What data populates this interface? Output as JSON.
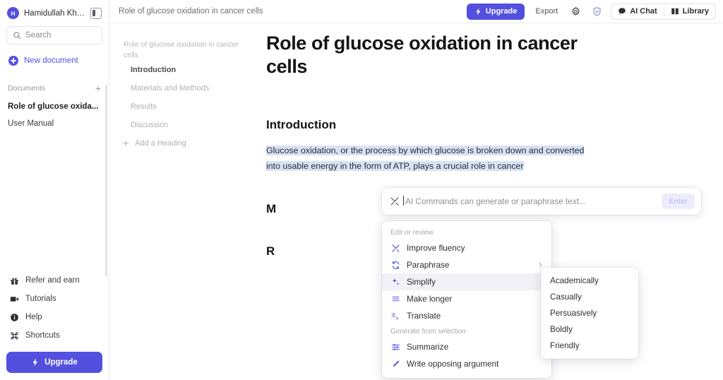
{
  "sidebar": {
    "user": {
      "initial": "H",
      "name": "Hamidullah Khan",
      "avatar_color": "#5350e0"
    },
    "panel_toggle": "toggle-sidebar",
    "search": {
      "placeholder": "Search"
    },
    "new_document": "New document",
    "documents_section": {
      "label": "Documents",
      "add": "+"
    },
    "documents": [
      {
        "label": "Role of glucose oxida...",
        "active": true
      },
      {
        "label": "User Manual",
        "active": false
      }
    ],
    "bottom_links": [
      {
        "label": "Refer and earn",
        "icon": "gift-icon"
      },
      {
        "label": "Tutorials",
        "icon": "video-camera-icon"
      },
      {
        "label": "Help",
        "icon": "info-icon"
      },
      {
        "label": "Shortcuts",
        "icon": "command-icon"
      }
    ],
    "upgrade": {
      "label": "Upgrade",
      "icon": "lightning-icon",
      "color": "#5350e0"
    }
  },
  "topbar": {
    "title": "Role of glucose oxidation in cancer cells",
    "upgrade": "Upgrade",
    "export": "Export",
    "settings_icon": "gear-icon",
    "shield_icon": "shield-check-icon",
    "ai_chat": "AI Chat",
    "library": "Library"
  },
  "outline": {
    "doc_title": "Role of glucose oxidation in cancer cells",
    "items": [
      {
        "label": "Introduction",
        "active": true
      },
      {
        "label": "Materials and Methods",
        "active": false
      },
      {
        "label": "Results",
        "active": false
      },
      {
        "label": "Discussion",
        "active": false
      }
    ],
    "add_heading": "Add a Heading"
  },
  "document": {
    "title": "Role of glucose oxidation in cancer cells",
    "section1_heading": "Introduction",
    "paragraph_highlighted": "Glucose oxidation, or the process by which glucose is broken down and converted into usable energy in the form of ATP, plays a crucial role in cancer",
    "section2_heading": "M",
    "section3_heading": "R"
  },
  "ai_command_bar": {
    "placeholder": "AI Commands can generate or paraphrase text...",
    "value": "",
    "icon": "magic-wand-icon",
    "enter_label": "Enter"
  },
  "menu": {
    "section1_label": "Edit or review",
    "section1_items": [
      {
        "label": "Improve fluency",
        "icon": "magic-wand-icon",
        "has_submenu": false,
        "hover": false
      },
      {
        "label": "Paraphrase",
        "icon": "refresh-icon",
        "has_submenu": true,
        "hover": false
      },
      {
        "label": "Simplify",
        "icon": "sparkles-icon",
        "has_submenu": false,
        "hover": true
      },
      {
        "label": "Make longer",
        "icon": "lines-icon",
        "has_submenu": false,
        "hover": false
      },
      {
        "label": "Translate",
        "icon": "translate-icon",
        "has_submenu": false,
        "hover": false
      }
    ],
    "section2_label": "Generate from selection",
    "section2_items": [
      {
        "label": "Summarize",
        "icon": "sliders-icon",
        "has_submenu": false,
        "hover": false
      },
      {
        "label": "Write opposing argument",
        "icon": "pencil-icon",
        "has_submenu": false,
        "hover": false
      }
    ]
  },
  "submenu": {
    "items": [
      {
        "label": "Academically"
      },
      {
        "label": "Casually"
      },
      {
        "label": "Persuasively"
      },
      {
        "label": "Boldly"
      },
      {
        "label": "Friendly"
      }
    ]
  },
  "colors": {
    "accent": "#5350e0",
    "highlight": "#d6e3f5",
    "menu_hover": "#f1f1f7"
  }
}
